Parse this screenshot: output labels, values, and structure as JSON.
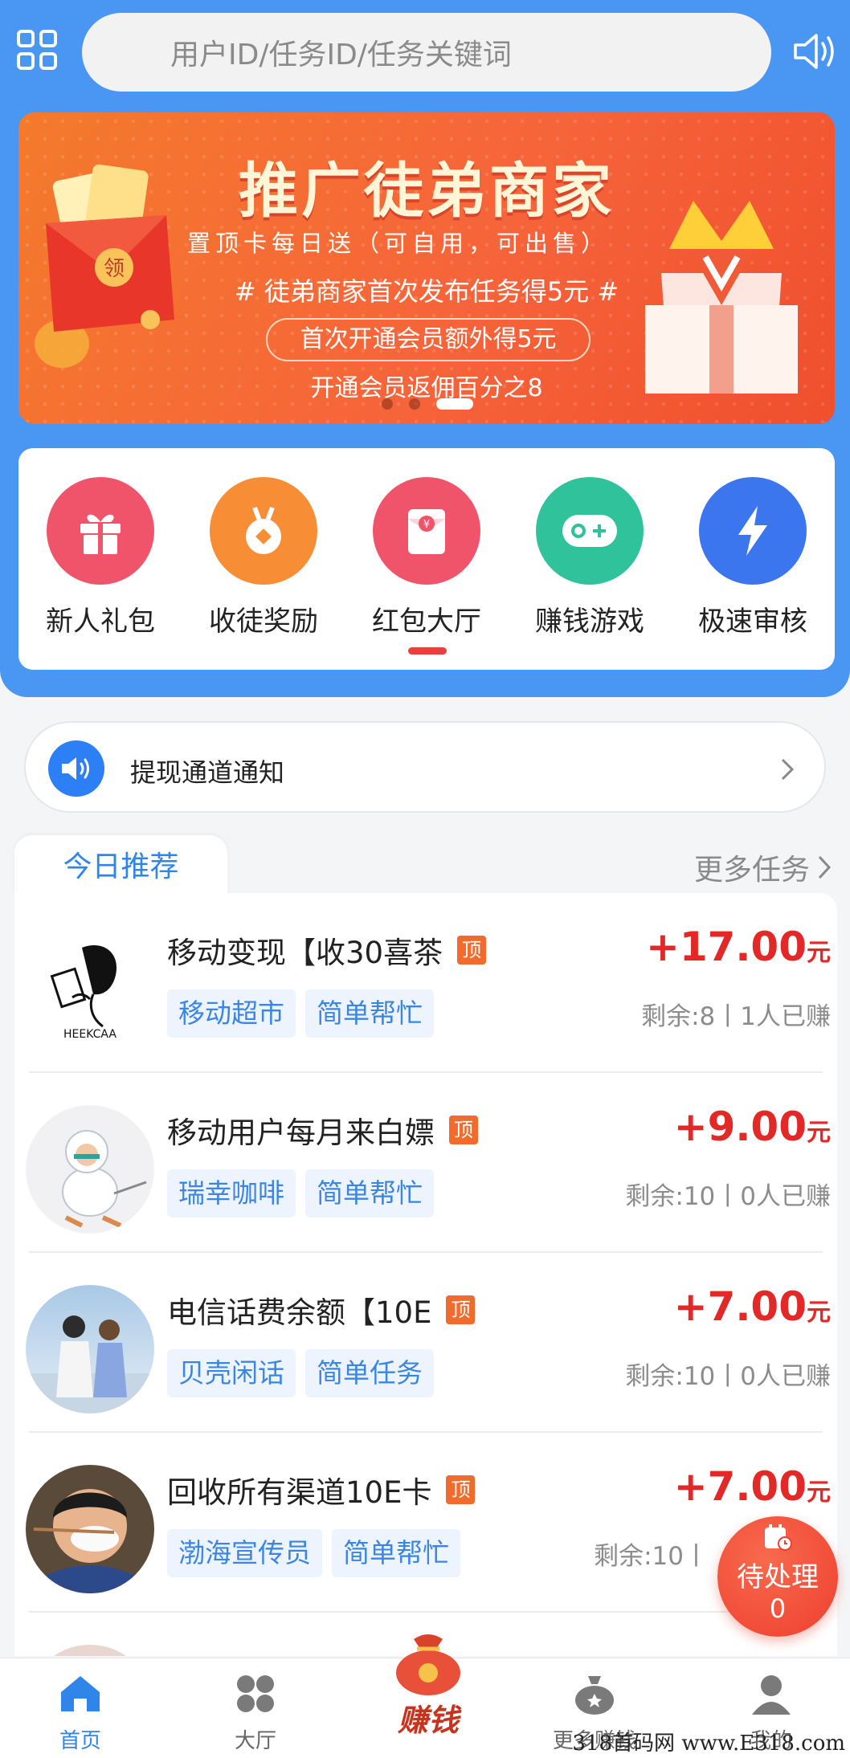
{
  "header": {
    "search_placeholder": "用户ID/任务ID/任务关键词"
  },
  "banner": {
    "title": "推广徒弟商家",
    "subtitle": "置顶卡每日送（可自用，可出售）",
    "line1": "# 徒弟商家首次发布任务得5元 #",
    "pill": "首次开通会员额外得5元",
    "line3": "开通会员返佣百分之8",
    "envelope_text": "领",
    "colors": {
      "primary": "#4a96f3",
      "banner": "#f6643a"
    }
  },
  "quick_menu": [
    {
      "label": "新人礼包",
      "icon": "gift-icon",
      "color": "#f0546b"
    },
    {
      "label": "收徒奖励",
      "icon": "medal-icon",
      "color": "#f78d35"
    },
    {
      "label": "红包大厅",
      "icon": "red-envelope-icon",
      "color": "#f0546b"
    },
    {
      "label": "赚钱游戏",
      "icon": "gamepad-icon",
      "color": "#2fc29b"
    },
    {
      "label": "极速审核",
      "icon": "lightning-icon",
      "color": "#3c76ee"
    }
  ],
  "notice": {
    "text": "提现通道通知"
  },
  "section": {
    "tab_label": "今日推荐",
    "more_label": "更多任务"
  },
  "tasks": [
    {
      "title": "移动变现【收30喜茶",
      "badge": "顶",
      "tags": [
        "移动超市",
        "简单帮忙"
      ],
      "price": "+17.00",
      "unit": "元",
      "remaining": "剩余:8丨1人已赚",
      "avatar_text": "HEEKCAA"
    },
    {
      "title": "移动用户每月来白嫖",
      "badge": "顶",
      "tags": [
        "瑞幸咖啡",
        "简单帮忙"
      ],
      "price": "+9.00",
      "unit": "元",
      "remaining": "剩余:10丨0人已赚"
    },
    {
      "title": "电信话费余额【10E",
      "badge": "顶",
      "tags": [
        "贝壳闲话",
        "简单任务"
      ],
      "price": "+7.00",
      "unit": "元",
      "remaining": "剩余:10丨0人已赚"
    },
    {
      "title": "回收所有渠道10E卡",
      "badge": "顶",
      "tags": [
        "渤海宣传员",
        "简单帮忙"
      ],
      "price": "+7.00",
      "unit": "元",
      "remaining": "剩余:10丨"
    }
  ],
  "fab": {
    "label": "待处理",
    "count": "0"
  },
  "tabbar": {
    "home": "首页",
    "hall": "大厅",
    "earn": "赚钱",
    "more_earn": "更多赚钱",
    "mine": "我的"
  },
  "watermark": "318首码网 www.E318.com"
}
